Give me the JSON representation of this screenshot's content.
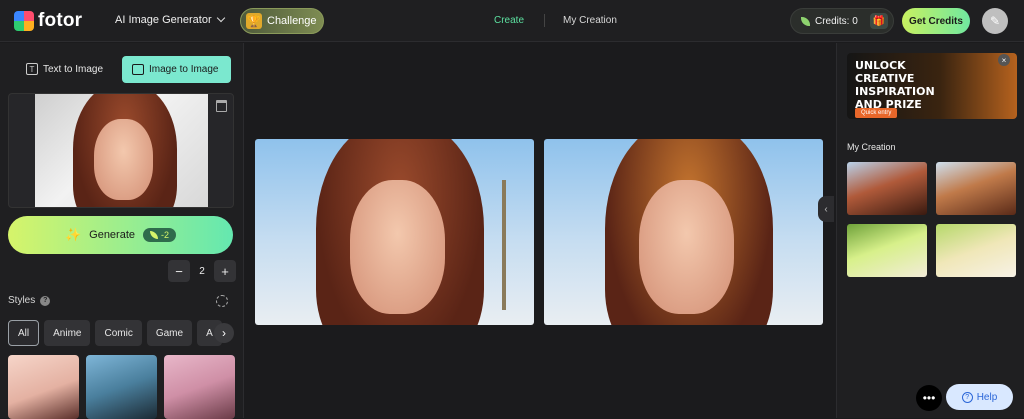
{
  "brand": {
    "name": "fotor"
  },
  "header": {
    "generator_menu": "AI Image Generator",
    "challenge": "Challenge",
    "nav": {
      "create": "Create",
      "my_creation": "My Creation"
    },
    "credits": "Credits: 0",
    "get_credits": "Get Credits"
  },
  "left": {
    "tab_text_to_image": "Text to Image",
    "tab_image_to_image": "Image to Image",
    "generate": {
      "label": "Generate",
      "cost": "-2"
    },
    "count": {
      "minus": "−",
      "value": "2",
      "plus": "+"
    },
    "styles_label": "Styles",
    "styles_chips": [
      "All",
      "Anime",
      "Comic",
      "Game",
      "A"
    ]
  },
  "right": {
    "banner": {
      "title": "UNLOCK CREATIVE INSPIRATION AND PRIZE",
      "cta": "Quick entry"
    },
    "my_creation_title": "My Creation"
  },
  "footer": {
    "help": "Help"
  },
  "colors": {
    "accent_green": "#5ce0a0",
    "generate_gradient_start": "#d6f46a",
    "generate_gradient_end": "#64e8b0",
    "tab_active": "#7be8cf"
  },
  "icons": [
    "logo-icon",
    "chevron-down-icon",
    "trophy-icon",
    "leaf-icon",
    "gift-icon",
    "avatar-icon",
    "text-icon",
    "image-icon",
    "trash-icon",
    "magic-wand-icon",
    "help-icon",
    "settings-icon",
    "chevron-right-icon",
    "chevron-left-icon",
    "close-icon",
    "more-icon"
  ]
}
